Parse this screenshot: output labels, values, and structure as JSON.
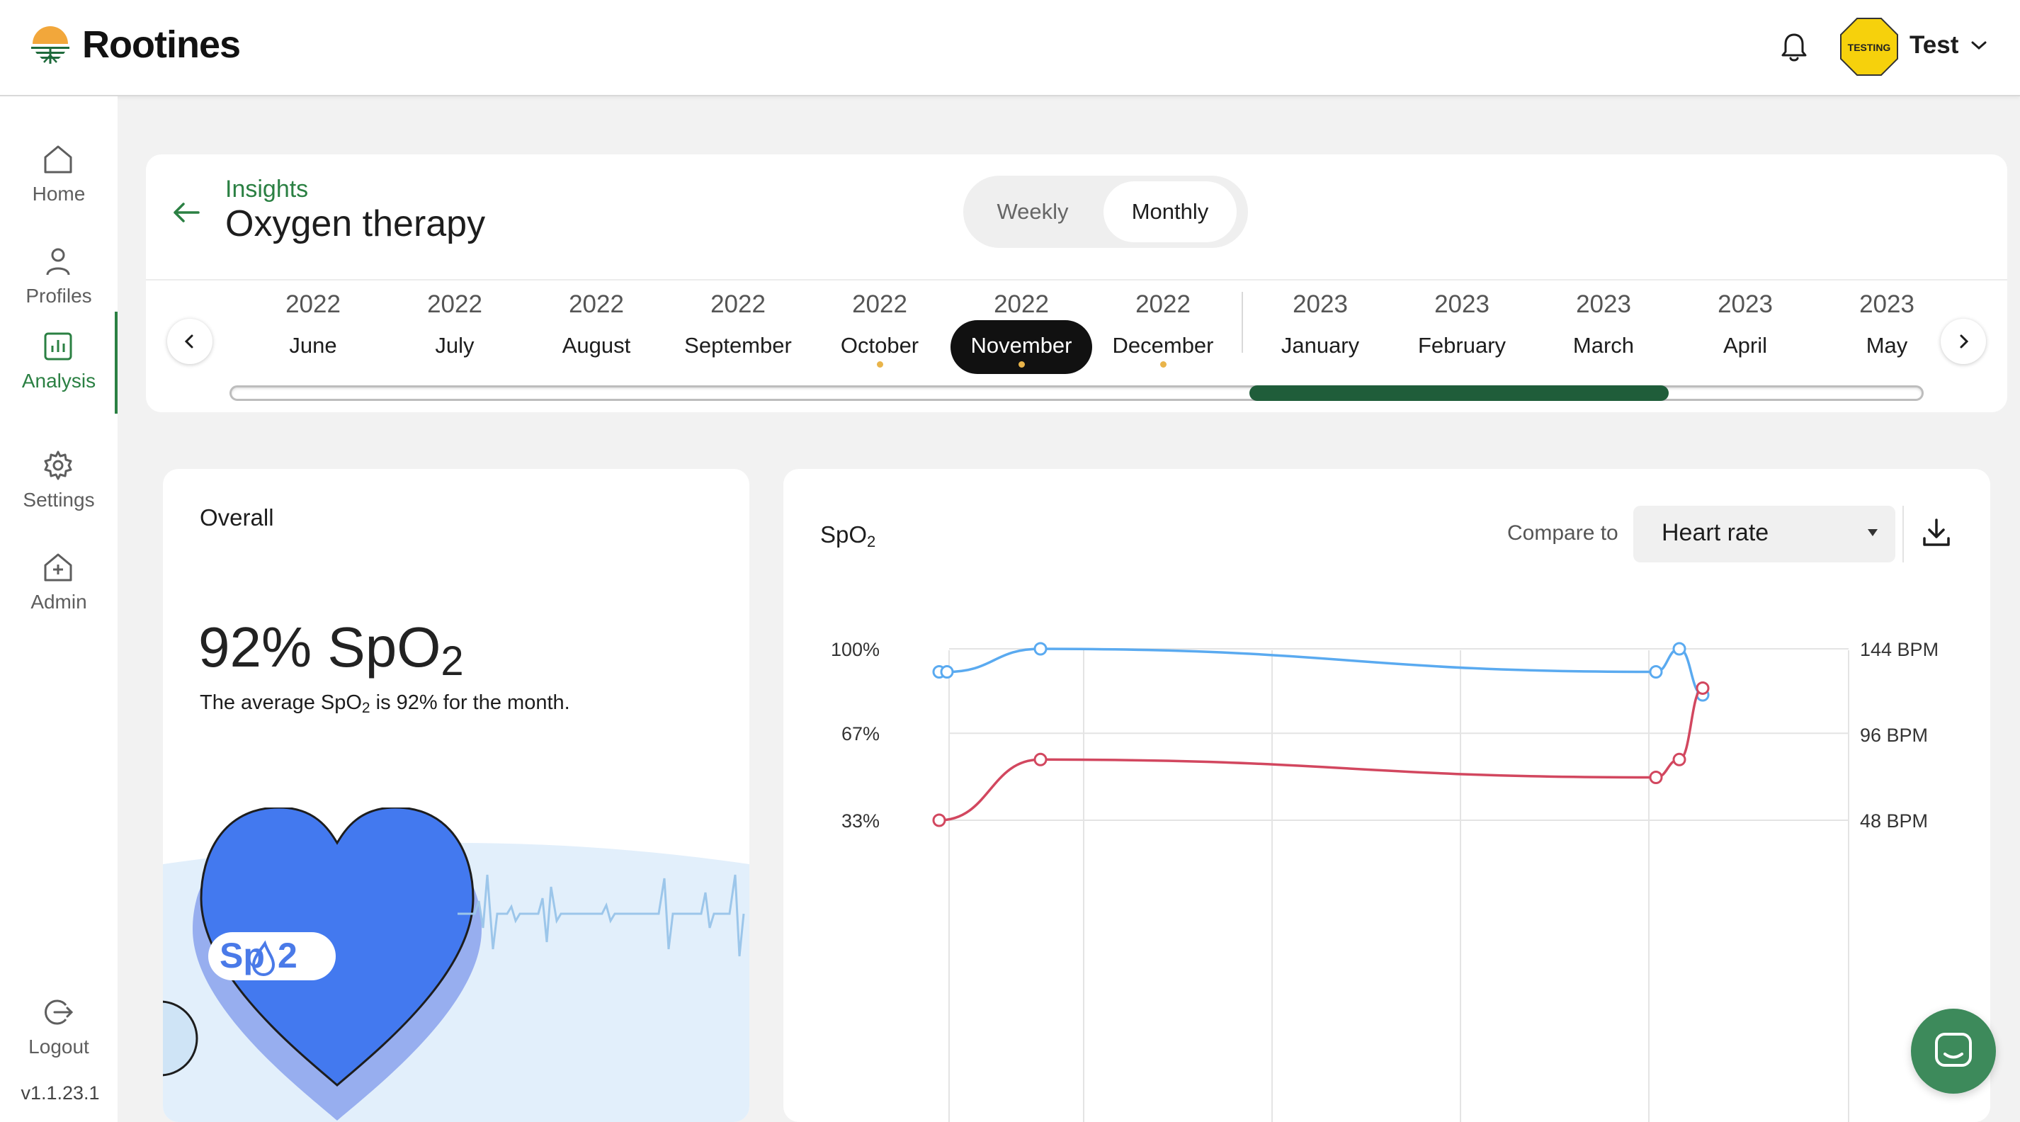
{
  "app": {
    "name": "Rootines"
  },
  "header": {
    "user_name": "Test",
    "avatar_badge": "TESTING",
    "avatar_color": "#f6d10c"
  },
  "sidebar": {
    "items": [
      {
        "label": "Home",
        "icon": "home-icon"
      },
      {
        "label": "Profiles",
        "icon": "user-icon"
      },
      {
        "label": "Analysis",
        "icon": "chart-icon",
        "active": true
      },
      {
        "label": "Settings",
        "icon": "gear-icon"
      },
      {
        "label": "Admin",
        "icon": "admin-icon"
      }
    ],
    "logout_label": "Logout",
    "version": "v1.1.23.1"
  },
  "insights": {
    "breadcrumb": "Insights",
    "title": "Oxygen therapy",
    "toggle": {
      "weekly": "Weekly",
      "monthly": "Monthly",
      "selected": "Monthly"
    },
    "months": [
      {
        "year": "2022",
        "month": "June",
        "dot": false
      },
      {
        "year": "2022",
        "month": "July",
        "dot": false
      },
      {
        "year": "2022",
        "month": "August",
        "dot": false
      },
      {
        "year": "2022",
        "month": "September",
        "dot": false
      },
      {
        "year": "2022",
        "month": "October",
        "dot": true
      },
      {
        "year": "2022",
        "month": "November",
        "dot": true,
        "selected": true
      },
      {
        "year": "2022",
        "month": "December",
        "dot": true
      },
      {
        "year": "2023",
        "month": "January",
        "dot": false
      },
      {
        "year": "2023",
        "month": "February",
        "dot": false
      },
      {
        "year": "2023",
        "month": "March",
        "dot": false
      },
      {
        "year": "2023",
        "month": "April",
        "dot": false
      },
      {
        "year": "2023",
        "month": "May",
        "dot": false
      }
    ]
  },
  "overall": {
    "title": "Overall",
    "big_value": "92% SpO",
    "big_sub": "2",
    "desc_pre": "The average SpO",
    "desc_sub": "2",
    "desc_post": " is 92% for the month.",
    "badge_text_1": "Sp",
    "badge_text_2": "2"
  },
  "chart": {
    "title": "SpO",
    "title_sub": "2",
    "compare_label": "Compare to",
    "compare_value": "Heart rate",
    "colors": {
      "spo2": "#5aaaf0",
      "heart_rate": "#d2475f",
      "grid": "#e4e4e4",
      "accent": "#2b8043"
    }
  },
  "chart_data": {
    "type": "line",
    "left_axis": {
      "ticks": [
        "100%",
        "67%",
        "33%"
      ],
      "values": [
        100,
        67,
        33
      ]
    },
    "right_axis": {
      "ticks": [
        "144 BPM",
        "96 BPM",
        "48 BPM"
      ],
      "values": [
        144,
        96,
        48
      ]
    },
    "series": [
      {
        "axis": "left",
        "points": [
          [
            0,
            91
          ],
          [
            0.01,
            91
          ],
          [
            0.13,
            100
          ],
          [
            0.92,
            91
          ],
          [
            0.95,
            100
          ],
          [
            0.98,
            82
          ]
        ]
      },
      {
        "axis": "right",
        "points": [
          [
            0,
            48
          ],
          [
            0.13,
            82
          ],
          [
            0.92,
            72
          ],
          [
            0.95,
            82
          ],
          [
            0.98,
            122
          ]
        ]
      }
    ]
  }
}
